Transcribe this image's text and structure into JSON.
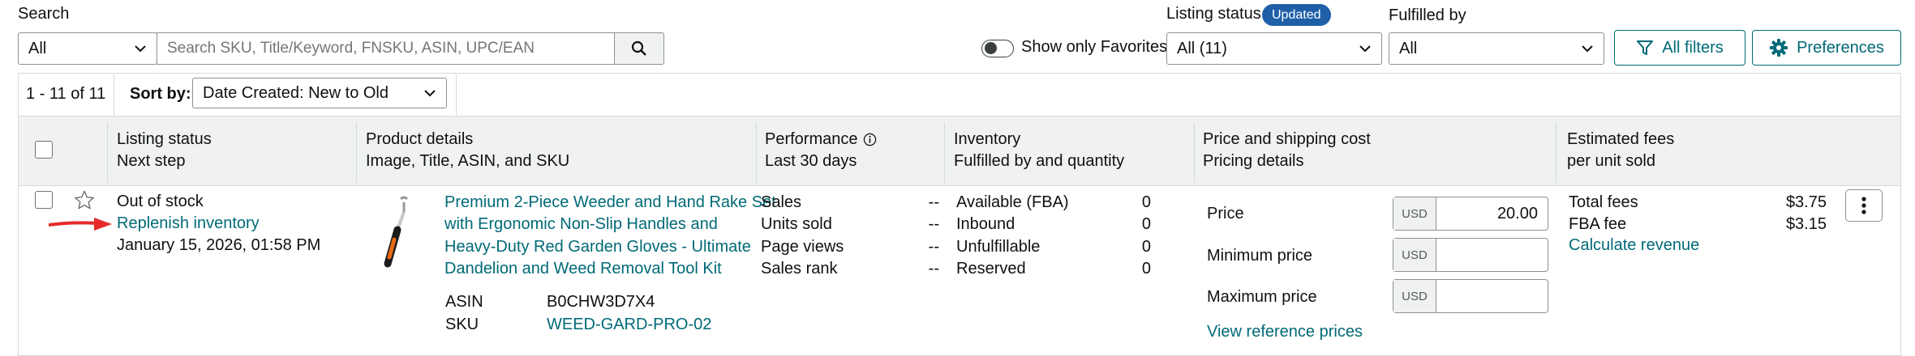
{
  "search": {
    "label": "Search",
    "scope_value": "All",
    "placeholder": "Search SKU, Title/Keyword, FNSKU, ASIN, UPC/EAN"
  },
  "favorites": {
    "label": "Show only Favorites"
  },
  "listing_status": {
    "label": "Listing status",
    "badge": "Updated",
    "value": "All (11)"
  },
  "fulfilled_by": {
    "label": "Fulfilled by",
    "value": "All"
  },
  "buttons": {
    "all_filters": "All filters",
    "preferences": "Preferences"
  },
  "results": {
    "count": "1 - 11 of 11",
    "sort_label": "Sort by:",
    "sort_value": "Date Created: New to Old"
  },
  "columns": [
    {
      "line1": "Listing status",
      "line2": "Next step"
    },
    {
      "line1": "Product details",
      "line2": "Image, Title, ASIN, and SKU"
    },
    {
      "line1": "Performance",
      "line2": "Last 30 days"
    },
    {
      "line1": "Inventory",
      "line2": "Fulfilled by and quantity"
    },
    {
      "line1": "Price and shipping cost",
      "line2": "Pricing details"
    },
    {
      "line1": "Estimated fees",
      "line2": "per unit sold"
    }
  ],
  "row": {
    "status": "Out of stock",
    "next_step": "Replenish inventory",
    "date": "January 15, 2026, 01:58 PM",
    "title_lines": [
      "Premium 2-Piece Weeder and Hand Rake Set",
      "with Ergonomic Non-Slip Handles and",
      "Heavy-Duty Red Garden Gloves - Ultimate",
      "Dandelion and Weed Removal Tool Kit"
    ],
    "asin_label": "ASIN",
    "asin": "B0CHW3D7X4",
    "sku_label": "SKU",
    "sku": "WEED-GARD-PRO-02",
    "performance": [
      {
        "label": "Sales",
        "value": "--"
      },
      {
        "label": "Units sold",
        "value": "--"
      },
      {
        "label": "Page views",
        "value": "--"
      },
      {
        "label": "Sales rank",
        "value": "--"
      }
    ],
    "inventory": [
      {
        "label": "Available (FBA)",
        "value": "0"
      },
      {
        "label": "Inbound",
        "value": "0"
      },
      {
        "label": "Unfulfillable",
        "value": "0"
      },
      {
        "label": "Reserved",
        "value": "0"
      }
    ],
    "price_label": "Price",
    "price_currency": "USD",
    "price_value": "20.00",
    "min_price_label": "Minimum price",
    "min_currency": "USD",
    "max_price_label": "Maximum price",
    "max_currency": "USD",
    "view_reference": "View reference prices",
    "fees": [
      {
        "label": "Total fees",
        "value": "$3.75"
      },
      {
        "label": "FBA fee",
        "value": "$3.15"
      }
    ],
    "calculate_revenue": "Calculate revenue"
  },
  "colors": {
    "teal": "#006a77",
    "badge": "#1f5fa8",
    "arrow": "#e62a2a",
    "header_bg": "#f0f2f2"
  }
}
